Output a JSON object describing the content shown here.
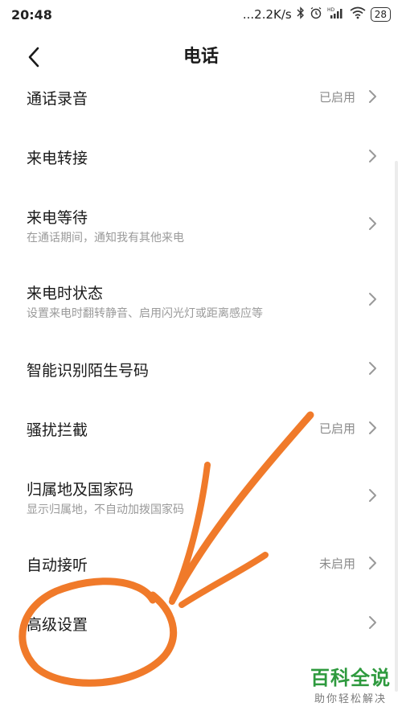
{
  "status_bar": {
    "time": "20:48",
    "network_speed": "...2.2K/s",
    "icons": [
      "bluetooth-icon",
      "alarm-icon",
      "hd-signal-icon",
      "wifi-icon"
    ],
    "battery": "28"
  },
  "header": {
    "back_icon": "chevron-left-icon",
    "title": "电话"
  },
  "settings": {
    "items": [
      {
        "title": "通话录音",
        "subtitle": "",
        "value": "已启用"
      },
      {
        "title": "来电转接",
        "subtitle": "",
        "value": ""
      },
      {
        "title": "来电等待",
        "subtitle": "在通话期间，通知我有其他来电",
        "value": ""
      },
      {
        "title": "来电时状态",
        "subtitle": "设置来电时翻转静音、启用闪光灯或距离感应等",
        "value": ""
      },
      {
        "title": "智能识别陌生号码",
        "subtitle": "",
        "value": ""
      },
      {
        "title": "骚扰拦截",
        "subtitle": "",
        "value": "已启用"
      },
      {
        "title": "归属地及国家码",
        "subtitle": "显示归属地，不自动加拨国家码",
        "value": ""
      },
      {
        "title": "自动接听",
        "subtitle": "",
        "value": "未启用"
      },
      {
        "title": "高级设置",
        "subtitle": "",
        "value": ""
      }
    ]
  },
  "watermark": {
    "title": "百科全说",
    "subtitle": "助你轻松解决"
  },
  "colors": {
    "annotation": "#f07a2a",
    "watermark_green": "#2e9a3e"
  }
}
